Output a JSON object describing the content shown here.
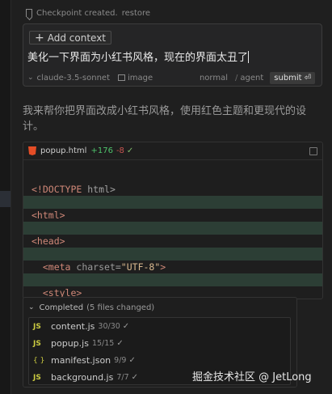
{
  "checkpoint": {
    "text": "Checkpoint created.",
    "restore": "restore"
  },
  "composer": {
    "add_context": "Add context",
    "prompt": "美化一下界面为小红书风格，现在的界面太丑了",
    "model": "claude-3.5-sonnet",
    "image_label": "image",
    "mode_normal": "normal",
    "mode_sep": "/",
    "mode_agent": "agent",
    "submit": "submit"
  },
  "response": {
    "text": "我来帮你把界面改成小红书风格，使用红色主题和更现代的设计。"
  },
  "file_diff": {
    "filename": "popup.html",
    "added": "+176",
    "removed": "-8",
    "lines": [
      {
        "tag_open": "<!",
        "kw": "DOCTYPE",
        "rest": " html>"
      },
      {
        "text": ""
      },
      {
        "tag": "<html>"
      },
      {
        "text": ""
      },
      {
        "tag": "<head>"
      },
      {
        "text": ""
      },
      {
        "indent": "  ",
        "tag": "<meta",
        "attr": " charset=",
        "str": "\"UTF-8\"",
        "close": ">"
      },
      {
        "text": ""
      },
      {
        "indent": "  ",
        "tag": "<style>"
      }
    ]
  },
  "completed": {
    "label": "Completed",
    "count": "(5 files changed)",
    "files": [
      {
        "icon": "JS",
        "name": "content.js",
        "count": "30/30"
      },
      {
        "icon": "JS",
        "name": "popup.js",
        "count": "15/15"
      },
      {
        "icon": "{ }",
        "name": "manifest.json",
        "count": "9/9"
      },
      {
        "icon": "JS",
        "name": "background.js",
        "count": "7/7"
      }
    ]
  },
  "watermark": "掘金技术社区 @ JetLong",
  "colors": {
    "accent_add": "#4ec26b",
    "accent_remove": "#c75450",
    "html_icon": "#e44d26",
    "js_icon": "#cbcb41"
  }
}
